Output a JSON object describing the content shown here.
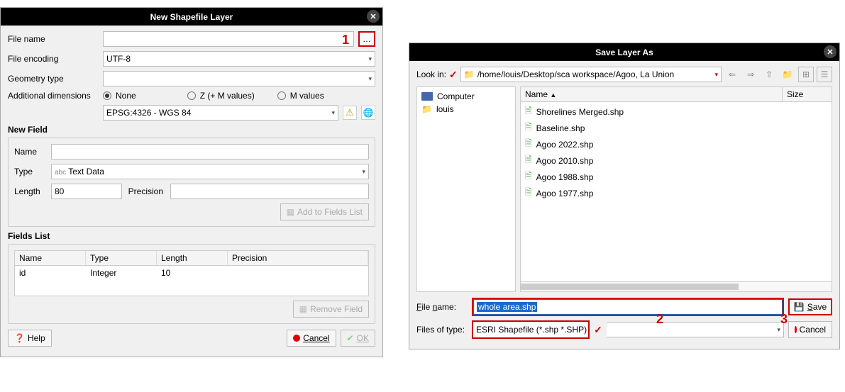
{
  "left_dialog": {
    "title": "New Shapefile Layer",
    "labels": {
      "file_name": "File name",
      "file_encoding": "File encoding",
      "geometry_type": "Geometry type",
      "additional_dims": "Additional dimensions",
      "rb_none": "None",
      "rb_z": "Z (+ M values)",
      "rb_m": "M values"
    },
    "encoding_value": "UTF-8",
    "crs_value": "EPSG:4326 - WGS 84",
    "browse_glyph": "…",
    "new_field": {
      "title": "New Field",
      "name_label": "Name",
      "type_label": "Type",
      "type_value": "Text Data",
      "type_prefix": "abc",
      "length_label": "Length",
      "length_value": "80",
      "precision_label": "Precision",
      "add_btn": "Add to Fields List"
    },
    "fields_list": {
      "title": "Fields List",
      "headers": {
        "name": "Name",
        "type": "Type",
        "length": "Length",
        "precision": "Precision"
      },
      "rows": [
        {
          "name": "id",
          "type": "Integer",
          "length": "10",
          "precision": ""
        }
      ],
      "remove_btn": "Remove Field"
    },
    "buttons": {
      "help": "Help",
      "cancel": "Cancel",
      "ok": "OK"
    }
  },
  "right_dialog": {
    "title": "Save Layer As",
    "look_in_label": "Look in:",
    "path": "/home/louis/Desktop/sca workspace/Agoo, La Union",
    "side_items": [
      "Computer",
      "louis"
    ],
    "headers": {
      "name": "Name",
      "size": "Size"
    },
    "files": [
      "Shorelines Merged.shp",
      "Baseline.shp",
      "Agoo 2022.shp",
      "Agoo 2010.shp",
      "Agoo 1988.shp",
      "Agoo 1977.shp"
    ],
    "file_name_label": "File name:",
    "file_name_value": "whole area.shp",
    "files_of_type_label": "Files of type:",
    "files_of_type_value": "ESRI Shapefile (*.shp *.SHP)",
    "save_btn": "Save",
    "cancel_btn": "Cancel"
  },
  "annotations": {
    "a1": "1",
    "a2": "2",
    "a3": "3"
  }
}
